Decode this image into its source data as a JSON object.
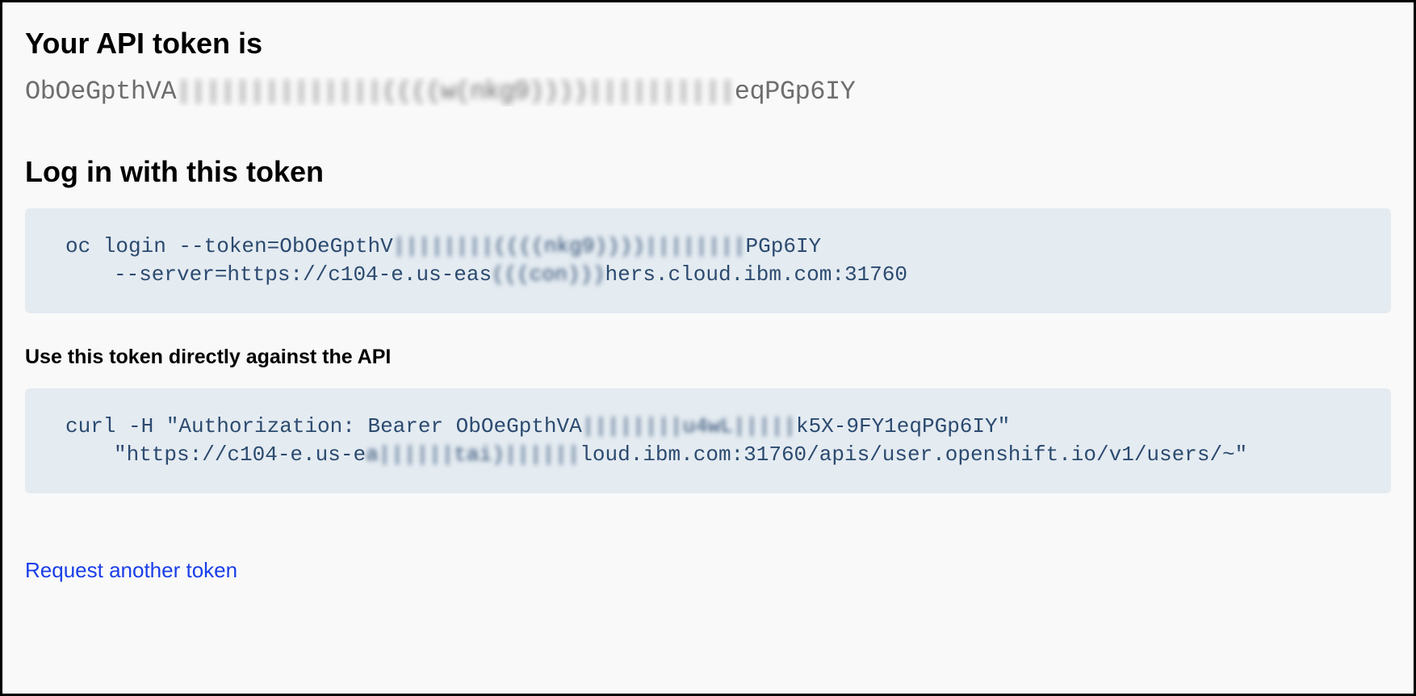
{
  "headings": {
    "token_label": "Your API token is",
    "login_label": "Log in with this token",
    "api_label": "Use this token directly against the API"
  },
  "token": {
    "prefix": "ObOeGpthVA",
    "redacted": "||||||||||||||((((w(nkg9))))||||||||||",
    "suffix": "eqPGp6IY"
  },
  "login_command": {
    "line1_pre": "oc login --token=ObOeGpthV",
    "line1_blur": "||||||||((((nkg9))))||||||||",
    "line1_post": "PGp6IY",
    "line2_pre": "--server=https://c104-e.us-eas",
    "line2_blur": "(((con)))",
    "line2_post": "hers.cloud.ibm.com:31760"
  },
  "curl_command": {
    "line1_pre": "curl -H \"Authorization: Bearer ObOeGpthVA",
    "line1_blur": "||||||||u4wL|||||",
    "line1_post": "k5X-9FY1eqPGp6IY\"",
    "line2_pre": "\"https://c104-e.us-e",
    "line2_blur": "a||||||tai)||||||",
    "line2_post": "loud.ibm.com:31760/apis/user.openshift.io/v1/users/~\""
  },
  "link": {
    "request_another": "Request another token"
  }
}
